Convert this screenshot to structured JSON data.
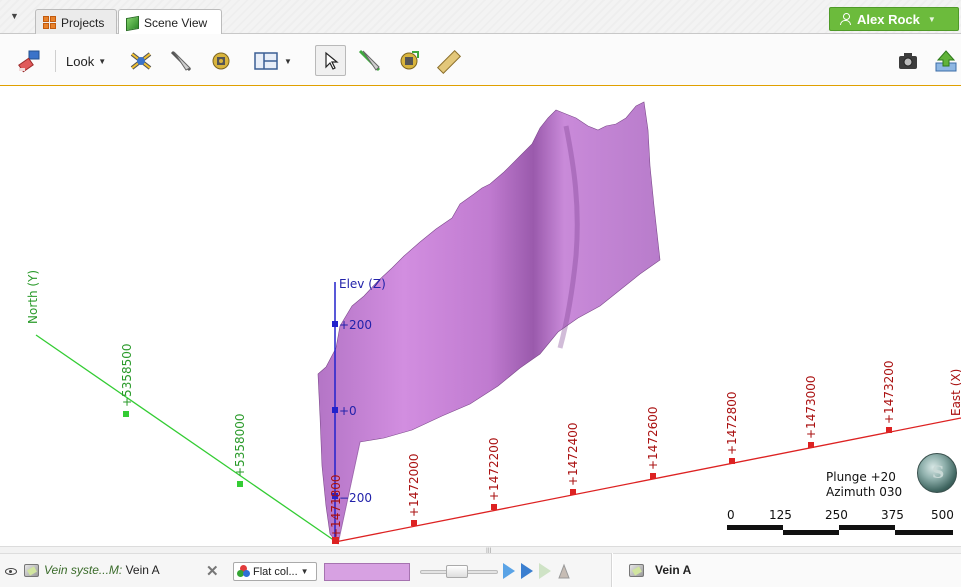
{
  "tabs": {
    "menu_caret": "▼",
    "projects_label": "Projects",
    "scene_label": "Scene View"
  },
  "user": {
    "name": "Alex Rock",
    "caret": "▼"
  },
  "toolbar": {
    "look_label": "Look"
  },
  "scene": {
    "axes": {
      "north_label": "North (Y)",
      "elev_label": "Elev (Z)",
      "east_label": "East (X)",
      "north_ticks": [
        "+5358500",
        "+5358000"
      ],
      "elev_ticks": [
        "+200",
        "+0",
        "−200"
      ],
      "east_ticks": [
        "+1472000",
        "+1472200",
        "+1472400",
        "+1472600",
        "+1472800",
        "+1473000",
        "+1473200"
      ],
      "origin_label": "+1471800"
    },
    "orientation": {
      "plunge": "Plunge +20",
      "azimuth": "Azimuth 030"
    },
    "scale_bar": {
      "labels": [
        "0",
        "125",
        "250",
        "375",
        "500"
      ]
    },
    "compass_letter": "S",
    "surface_color": "#c685d6"
  },
  "shape_list": {
    "object_prefix": "Vein syste...M:",
    "object_name": "Vein A",
    "color_mode": "Flat col...",
    "color_swatch": "#d7a1e2"
  },
  "properties": {
    "title": "Vein A"
  }
}
